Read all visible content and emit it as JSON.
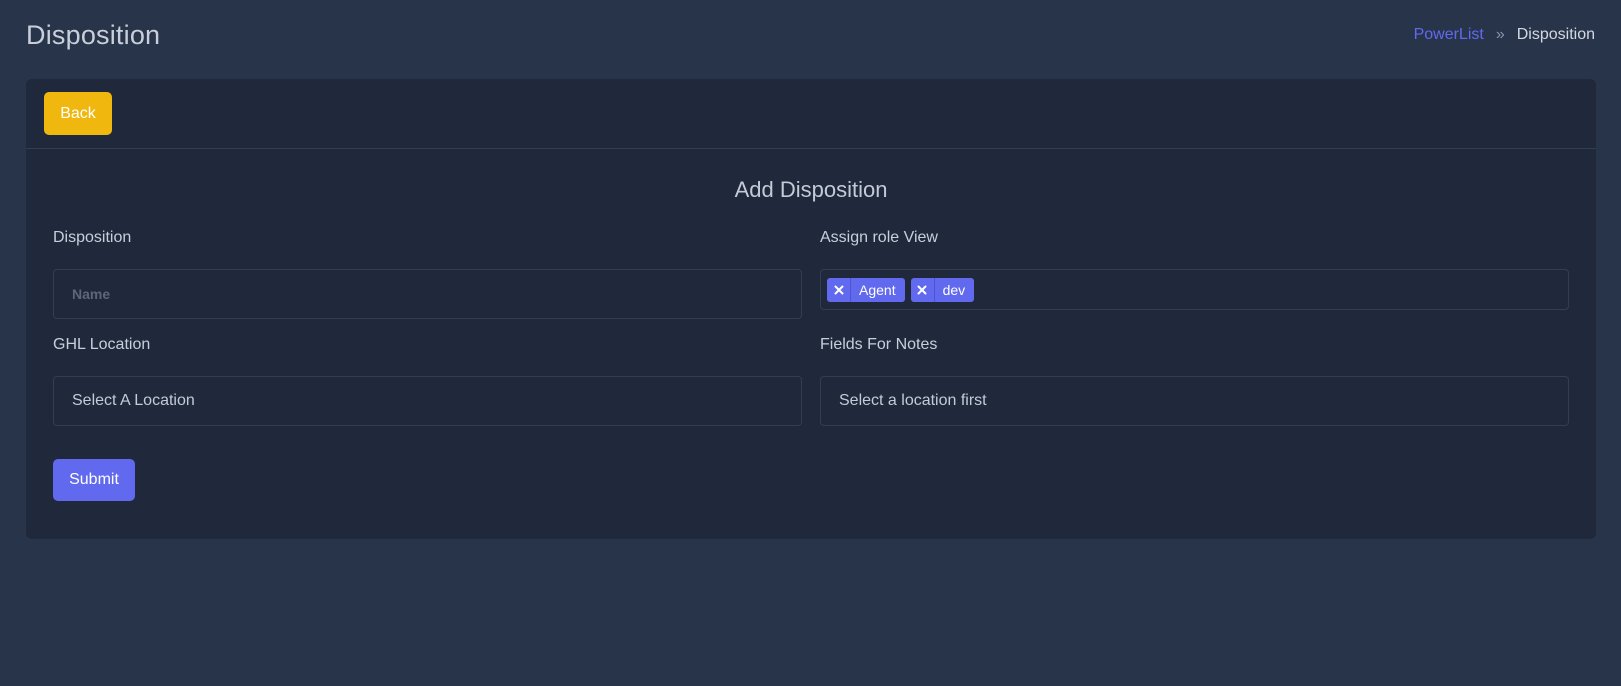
{
  "header": {
    "title": "Disposition",
    "breadcrumb": {
      "link": "PowerList",
      "separator": "»",
      "current": "Disposition"
    }
  },
  "card": {
    "back_label": "Back",
    "form_title": "Add Disposition",
    "disposition": {
      "label": "Disposition",
      "placeholder": "Name",
      "value": ""
    },
    "assign_role": {
      "label": "Assign role View",
      "tags": [
        "Agent",
        "dev"
      ]
    },
    "ghl_location": {
      "label": "GHL Location",
      "selected": "Select A Location"
    },
    "fields_for_notes": {
      "label": "Fields For Notes",
      "selected": "Select a location first"
    },
    "submit_label": "Submit"
  },
  "colors": {
    "background": "#28344a",
    "card": "#1f293b",
    "accent": "#6169ef",
    "back_button": "#f0b70f"
  }
}
